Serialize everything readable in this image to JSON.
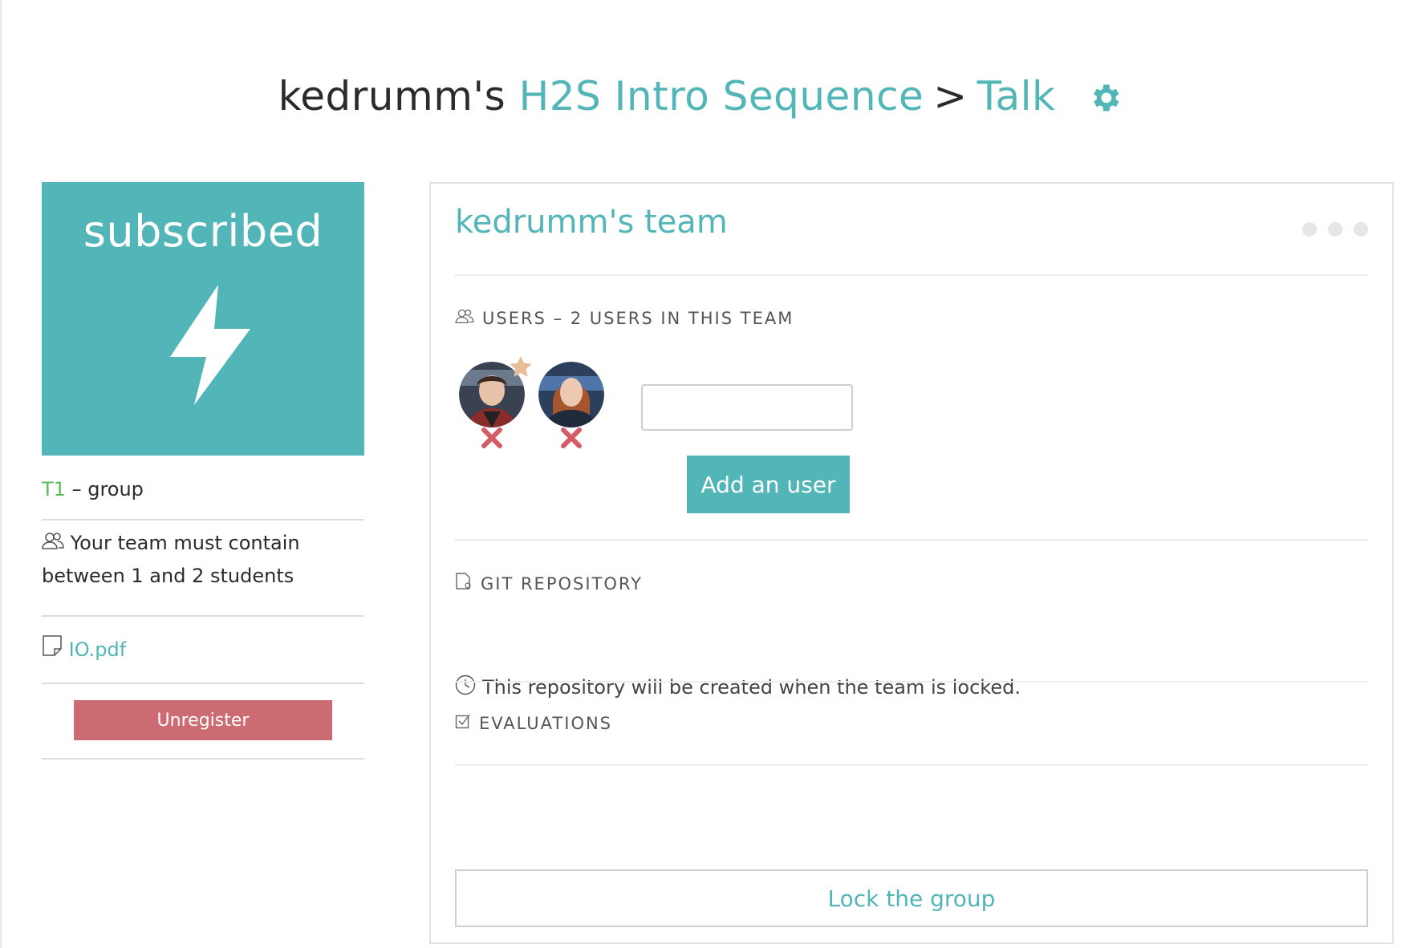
{
  "header": {
    "owner": "kedrumm's",
    "project": "H2S Intro Sequence",
    "separator": ">",
    "activity": "Talk",
    "settings_icon": "gear-icon"
  },
  "status": {
    "label": "subscribed",
    "icon": "lightning-bolt-icon",
    "color": "#52b5b8"
  },
  "group_info": {
    "tag": "T1",
    "type": "– group",
    "size_text": "Your team must contain between 1 and 2 students",
    "file_name": "IO.pdf",
    "unregister_label": "Unregister",
    "unregister_color": "#cc6b72"
  },
  "team": {
    "title": "kedrumm's team",
    "users_heading": "USERS – 2 USERS IN THIS TEAM",
    "users": [
      {
        "role": "owner",
        "remove_icon": "remove-x-icon"
      },
      {
        "role": "member",
        "remove_icon": "remove-x-icon"
      }
    ],
    "add_user_input_value": "",
    "add_user_label": "Add an user",
    "git_heading": "GIT REPOSITORY",
    "git_note": "This repository will be created when the team is locked.",
    "evaluations_heading": "EVALUATIONS",
    "lock_label": "Lock the group"
  }
}
